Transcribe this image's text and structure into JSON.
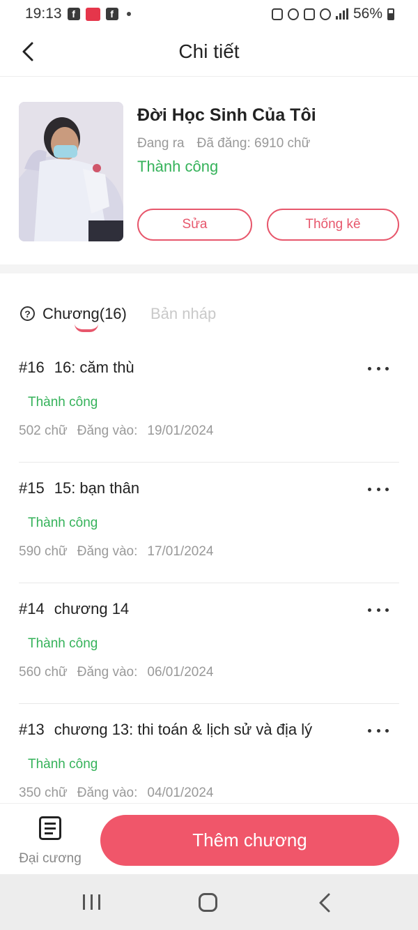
{
  "status_bar": {
    "time": "19:13",
    "battery": "56%"
  },
  "header": {
    "title": "Chi tiết"
  },
  "story": {
    "title": "Đời Học Sinh Của Tôi",
    "state": "Đang ra",
    "words": "Đã đăng: 6910 chữ",
    "status": "Thành công",
    "edit_label": "Sửa",
    "stats_label": "Thống kê"
  },
  "tabs": {
    "help_symbol": "?",
    "chapters": "Chương(16)",
    "drafts": "Bản nháp"
  },
  "chapters": [
    {
      "number": "#16",
      "title": "16: căm thù",
      "status": "Thành công",
      "words": "502 chữ",
      "date_label": "Đăng vào:",
      "date": "19/01/2024"
    },
    {
      "number": "#15",
      "title": "15: bạn thân",
      "status": "Thành công",
      "words": "590 chữ",
      "date_label": "Đăng vào:",
      "date": "17/01/2024"
    },
    {
      "number": "#14",
      "title": "chương 14",
      "status": "Thành công",
      "words": "560 chữ",
      "date_label": "Đăng vào:",
      "date": "06/01/2024"
    },
    {
      "number": "#13",
      "title": "chương 13: thi toán & lịch sử và địa lý",
      "status": "Thành công",
      "words": "350 chữ",
      "date_label": "Đăng vào:",
      "date": "04/01/2024"
    }
  ],
  "bottom_bar": {
    "outline_label": "Đại cương",
    "add_chapter_label": "Thêm chương"
  },
  "colors": {
    "accent": "#f0566a",
    "success": "#35b25a"
  }
}
